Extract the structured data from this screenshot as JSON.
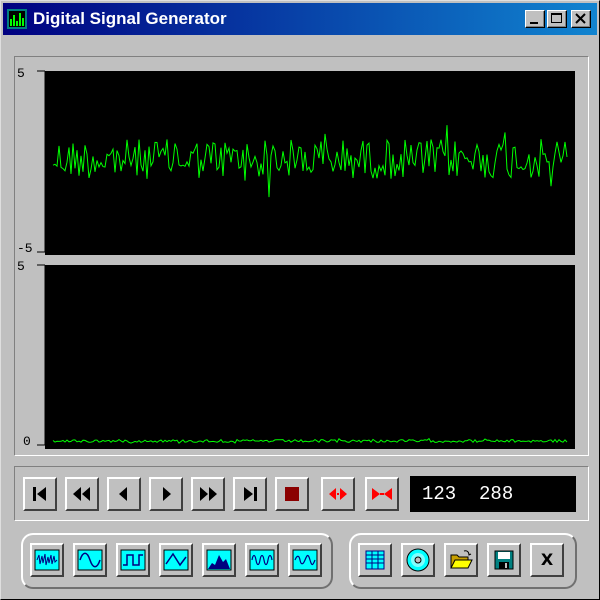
{
  "window": {
    "title": "Digital Signal Generator",
    "app_icon": "equalizer-app-icon",
    "controls": [
      "minimize-icon",
      "maximize-icon",
      "close-icon"
    ]
  },
  "colors": {
    "titlebar_start": "#000080",
    "titlebar_end": "#1084d0",
    "face": "#c0c0c0",
    "plot_background": "#000000",
    "trace": "#00ff00",
    "stop": "#8b0000",
    "marker_red": "#ff0000",
    "wave_button_bg": "#00ffff"
  },
  "top_plot": {
    "y_max_label": "5",
    "y_min_label": "-5",
    "trace": "green noise signal"
  },
  "bottom_plot": {
    "y_max_label": "5",
    "y_min_label": "0",
    "trace": "green low-level noise"
  },
  "transport": {
    "buttons": [
      {
        "name": "first-button",
        "icon": "skip-to-start-icon"
      },
      {
        "name": "rewind-button",
        "icon": "rewind-icon"
      },
      {
        "name": "step-back-button",
        "icon": "step-back-icon"
      },
      {
        "name": "play-button",
        "icon": "play-icon"
      },
      {
        "name": "fast-forward-button",
        "icon": "fast-forward-icon"
      },
      {
        "name": "last-button",
        "icon": "skip-to-end-icon"
      },
      {
        "name": "stop-button",
        "icon": "stop-icon"
      },
      {
        "name": "expand-button",
        "icon": "expand-arrows-icon"
      },
      {
        "name": "contract-button",
        "icon": "contract-arrows-icon"
      }
    ],
    "counter": "123  288"
  },
  "waveform_buttons": [
    {
      "name": "noise-wave-button",
      "icon": "noise-wave-icon"
    },
    {
      "name": "sine-wave-button",
      "icon": "sine-wave-icon"
    },
    {
      "name": "square-wave-button",
      "icon": "square-wave-icon"
    },
    {
      "name": "triangle-wave-button",
      "icon": "triangle-wave-icon"
    },
    {
      "name": "spectrum-button",
      "icon": "spectrum-icon"
    },
    {
      "name": "burst-wave-button",
      "icon": "burst-wave-icon"
    },
    {
      "name": "modulated-wave-button",
      "icon": "modulated-wave-icon"
    }
  ],
  "file_buttons": [
    {
      "name": "data-table-button",
      "icon": "grid-table-icon"
    },
    {
      "name": "disc-button",
      "icon": "cd-icon"
    },
    {
      "name": "open-button",
      "icon": "open-folder-icon"
    },
    {
      "name": "save-button",
      "icon": "floppy-disk-icon"
    },
    {
      "name": "exit-button",
      "icon": "x-close-icon",
      "label": "X"
    }
  ]
}
